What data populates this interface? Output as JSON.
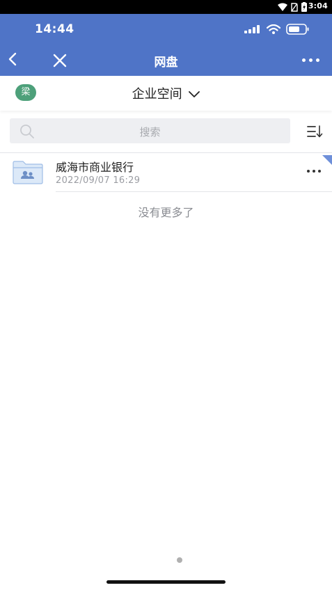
{
  "system": {
    "time": "3:04"
  },
  "header": {
    "inner_time": "14:44",
    "title": "网盘",
    "color": "#4f74c7"
  },
  "space": {
    "avatar_text": "梁",
    "avatar_color": "#4da07a",
    "selector_label": "企业空间"
  },
  "search": {
    "placeholder": "搜索"
  },
  "files": [
    {
      "name": "威海市商业银行",
      "time": "2022/09/07 16:29",
      "icon": "shared-folder-icon"
    }
  ],
  "list_footer": "没有更多了"
}
